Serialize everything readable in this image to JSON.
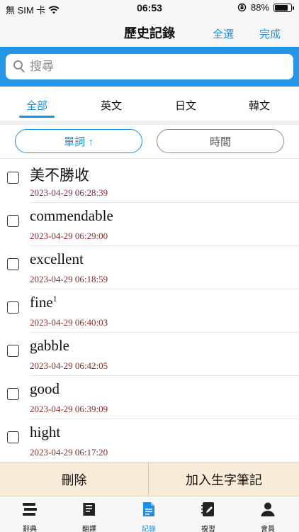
{
  "status_bar": {
    "carrier": "無 SIM 卡",
    "time": "06:53",
    "battery": "88%",
    "battery_level": 0.88
  },
  "nav": {
    "title": "歷史記錄",
    "select_all": "全選",
    "done": "完成"
  },
  "search": {
    "placeholder": "搜尋",
    "value": ""
  },
  "tabs": {
    "items": [
      {
        "label": "全部",
        "active": true
      },
      {
        "label": "英文",
        "active": false
      },
      {
        "label": "日文",
        "active": false
      },
      {
        "label": "韓文",
        "active": false
      }
    ]
  },
  "sort": {
    "word_label": "單詞 ↑",
    "time_label": "時間"
  },
  "entries": [
    {
      "word": "美不勝收",
      "sup": "",
      "timestamp": "2023-04-29 06:28:39",
      "checked": false
    },
    {
      "word": "commendable",
      "sup": "",
      "timestamp": "2023-04-29 06:29:00",
      "checked": false
    },
    {
      "word": "excellent",
      "sup": "",
      "timestamp": "2023-04-29 06:18:59",
      "checked": false
    },
    {
      "word": "fine",
      "sup": "1",
      "timestamp": "2023-04-29 06:40:03",
      "checked": false
    },
    {
      "word": "gabble",
      "sup": "",
      "timestamp": "2023-04-29 06:42:05",
      "checked": false
    },
    {
      "word": "good",
      "sup": "",
      "timestamp": "2023-04-29 06:39:09",
      "checked": false
    },
    {
      "word": "hight",
      "sup": "",
      "timestamp": "2023-04-29 06:17:20",
      "checked": false
    }
  ],
  "actions": {
    "delete": "刪除",
    "add_to_notebook": "加入生字筆記"
  },
  "tab_bar": {
    "items": [
      {
        "label": "辭典",
        "icon": "dictionary-icon",
        "active": false
      },
      {
        "label": "翻譯",
        "icon": "translate-book-icon",
        "active": false
      },
      {
        "label": "記錄",
        "icon": "history-document-icon",
        "active": true
      },
      {
        "label": "複習",
        "icon": "review-notebook-icon",
        "active": false
      },
      {
        "label": "會員",
        "icon": "member-person-icon",
        "active": false
      }
    ]
  },
  "colors": {
    "accent": "#1a8fe3",
    "search_band": "#2596e6",
    "timestamp": "#8b2a2a",
    "action_bar": "#f8ecd9"
  }
}
